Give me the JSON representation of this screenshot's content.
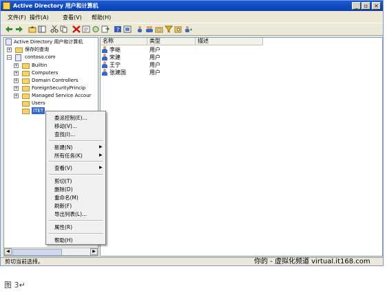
{
  "window": {
    "title": "Active Directory 用户和计算机",
    "min_glyph": "_",
    "max_glyph": "▫",
    "close_glyph": "×",
    "watermark": "你的 - 虚拟化频道 virtual.it168.com"
  },
  "menubar": {
    "items": [
      "文件(F)",
      "操作(A)",
      "查看(V)",
      "帮助(H)"
    ]
  },
  "toolbar": {
    "icons": [
      "back-icon",
      "forward-icon",
      "up-folder-icon",
      "show-hide-tree-icon",
      "cut-icon",
      "copy-icon",
      "delete-icon",
      "properties-icon",
      "refresh-icon",
      "export-icon",
      "help-icon",
      "help-topics-icon",
      "users-icon",
      "group-icon",
      "ou-icon",
      "filter-icon",
      "find-icon",
      "add-group-icon"
    ]
  },
  "tree": {
    "header": "Active Directory 用户和计算机",
    "items": [
      {
        "label": "保存的查询",
        "expander": "+"
      },
      {
        "label": "contoso.com",
        "expander": "−"
      },
      {
        "label": "Builtin",
        "expander": "+"
      },
      {
        "label": "Computers",
        "expander": "+"
      },
      {
        "label": "Domain Controllers",
        "expander": "+"
      },
      {
        "label": "ForeignSecurityPrincip",
        "expander": "+"
      },
      {
        "label": "Managed Service Accour",
        "expander": "+"
      },
      {
        "label": "Users",
        "expander": ""
      },
      {
        "label": "ITET",
        "expander": ""
      }
    ]
  },
  "list": {
    "columns": [
      "名称",
      "类型",
      "描述"
    ],
    "rows": [
      {
        "name": "李继",
        "type": "用户",
        "desc": ""
      },
      {
        "name": "宋建",
        "type": "用户",
        "desc": ""
      },
      {
        "name": "王宁",
        "type": "用户",
        "desc": ""
      },
      {
        "name": "张建国",
        "type": "用户",
        "desc": ""
      }
    ]
  },
  "context_menu": {
    "items": [
      {
        "label": "委派控制(E)..."
      },
      {
        "label": "移动(V)..."
      },
      {
        "label": "查找(I)..."
      },
      {
        "label": "新建(N)",
        "submenu": true
      },
      {
        "label": "所有任务(K)",
        "submenu": true
      },
      {
        "label": "查看(V)",
        "submenu": true
      },
      {
        "label": "剪切(T)"
      },
      {
        "label": "删除(D)"
      },
      {
        "label": "重命名(M)"
      },
      {
        "label": "刷新(F)"
      },
      {
        "label": "导出列表(L)..."
      },
      {
        "label": "属性(R)"
      },
      {
        "label": "帮助(H)"
      }
    ]
  },
  "statusbar": {
    "text": "剪切当前选择。"
  },
  "caption": "图 3↵"
}
